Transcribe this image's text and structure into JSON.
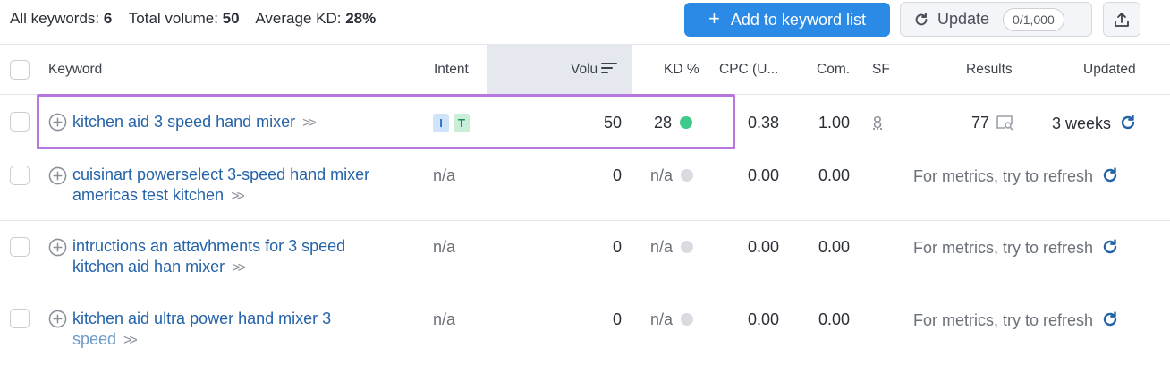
{
  "summary": {
    "all_keywords_label": "All keywords:",
    "all_keywords_value": "6",
    "total_volume_label": "Total volume:",
    "total_volume_value": "50",
    "avg_kd_label": "Average KD:",
    "avg_kd_value": "28%"
  },
  "toolbar": {
    "add_plus": "+",
    "add_label": "Add to keyword list",
    "update_label": "Update",
    "update_count": "0/1,000"
  },
  "columns": {
    "keyword": "Keyword",
    "intent": "Intent",
    "volume": "Volu",
    "kd": "KD %",
    "cpc": "CPC (U...",
    "com": "Com.",
    "sf": "SF",
    "results": "Results",
    "updated": "Updated"
  },
  "rows": [
    {
      "keyword_line1": "kitchen aid 3 speed hand mixer",
      "keyword_line2": "",
      "intent_badges": [
        "I",
        "T"
      ],
      "volume": "50",
      "kd": "28",
      "kd_color": "#3fc98a",
      "cpc": "0.38",
      "com": "1.00",
      "sf": "8",
      "results": "77",
      "updated": "3 weeks"
    },
    {
      "keyword_line1": "cuisinart powerselect 3-speed hand mixer",
      "keyword_line2": "americas test kitchen",
      "intent": "n/a",
      "volume": "0",
      "kd": "n/a",
      "kd_color": "#d9dbe0",
      "cpc": "0.00",
      "com": "0.00",
      "refresh_text": "For metrics, try to refresh"
    },
    {
      "keyword_line1": "intructions an attavhments for 3 speed",
      "keyword_line2": "kitchen aid han mixer",
      "intent": "n/a",
      "volume": "0",
      "kd": "n/a",
      "kd_color": "#d9dbe0",
      "cpc": "0.00",
      "com": "0.00",
      "refresh_text": "For metrics, try to refresh"
    },
    {
      "keyword_line1": "kitchen aid ultra power hand mixer 3",
      "keyword_line2": "speed",
      "intent": "n/a",
      "volume": "0",
      "kd": "n/a",
      "kd_color": "#d9dbe0",
      "cpc": "0.00",
      "com": "0.00",
      "refresh_text": "For metrics, try to refresh"
    }
  ],
  "colors": {
    "accent": "#2b8ae6",
    "link": "#2463a8",
    "highlight": "#b678de",
    "badge_i_bg": "#cfe3fb",
    "badge_i_fg": "#2a6fc2",
    "badge_t_bg": "#c9efd8",
    "badge_t_fg": "#1e8a4d"
  },
  "icons": {
    "add": "plus-icon",
    "update": "refresh-icon",
    "export": "upload-icon",
    "volume_sort": "sort-icon",
    "keyword_add": "plus-circle-icon",
    "expand": "double-chevron-icon",
    "serp": "serp-preview-icon",
    "row_refresh": "refresh-icon"
  }
}
